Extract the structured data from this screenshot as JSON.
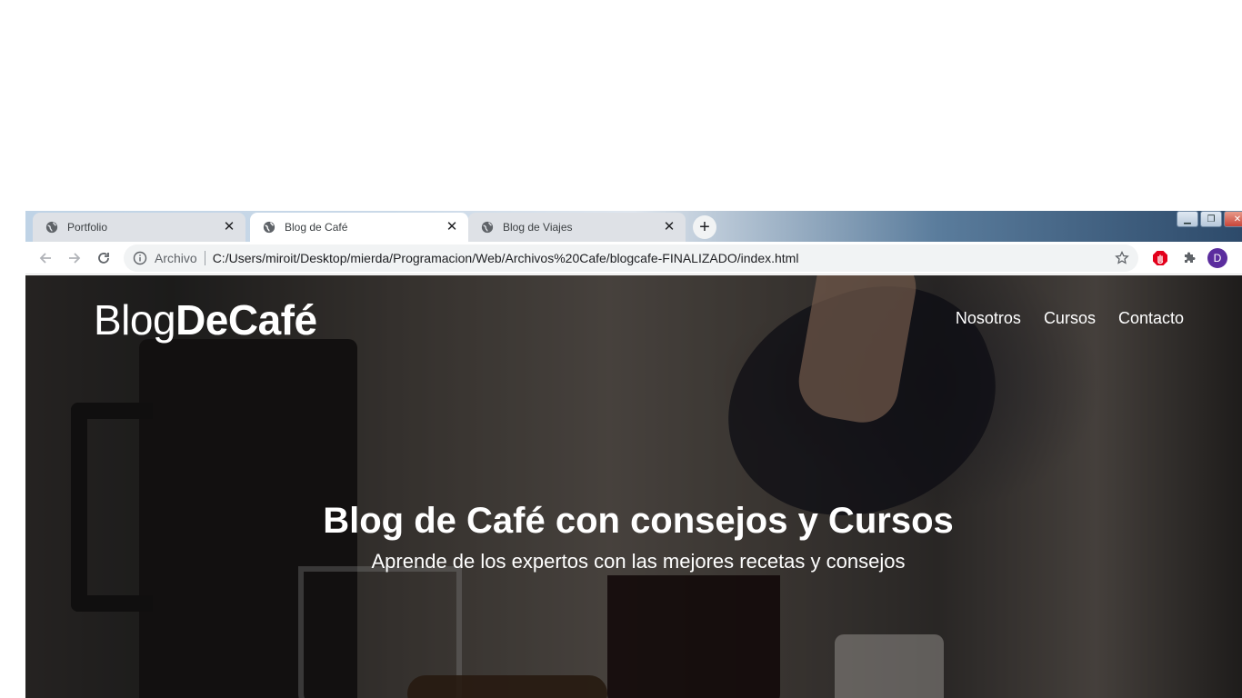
{
  "browser": {
    "tabs": [
      {
        "title": "Portfolio",
        "active": false
      },
      {
        "title": "Blog de Café",
        "active": true
      },
      {
        "title": "Blog de Viajes",
        "active": false
      }
    ],
    "close_glyph": "✕",
    "new_tab_glyph": "+",
    "address": {
      "scheme_label": "Archivo",
      "url": "C:/Users/miroit/Desktop/mierda/Programacion/Web/Archivos%20Cafe/blogcafe-FINALIZADO/index.html"
    },
    "profile_initial": "D"
  },
  "site": {
    "brand_part1": "Blog",
    "brand_part2": "DeCafé",
    "nav": [
      "Nosotros",
      "Cursos",
      "Contacto"
    ],
    "hero_title": "Blog de Café con consejos y Cursos",
    "hero_subtitle": "Aprende de los expertos con las mejores recetas y consejos"
  },
  "colors": {
    "accent_profile": "#5b2d9e",
    "extension_red": "#e3001b",
    "tab_inactive": "#dee1e6",
    "omnibox_bg": "#f1f3f4"
  },
  "icons": {
    "tab": "globe-icon",
    "back": "arrow-left-icon",
    "forward": "arrow-right-icon",
    "reload": "reload-icon",
    "info": "info-icon",
    "bookmark": "star-icon",
    "extension_1": "hand-stop-icon",
    "extension_2": "puzzle-icon"
  }
}
